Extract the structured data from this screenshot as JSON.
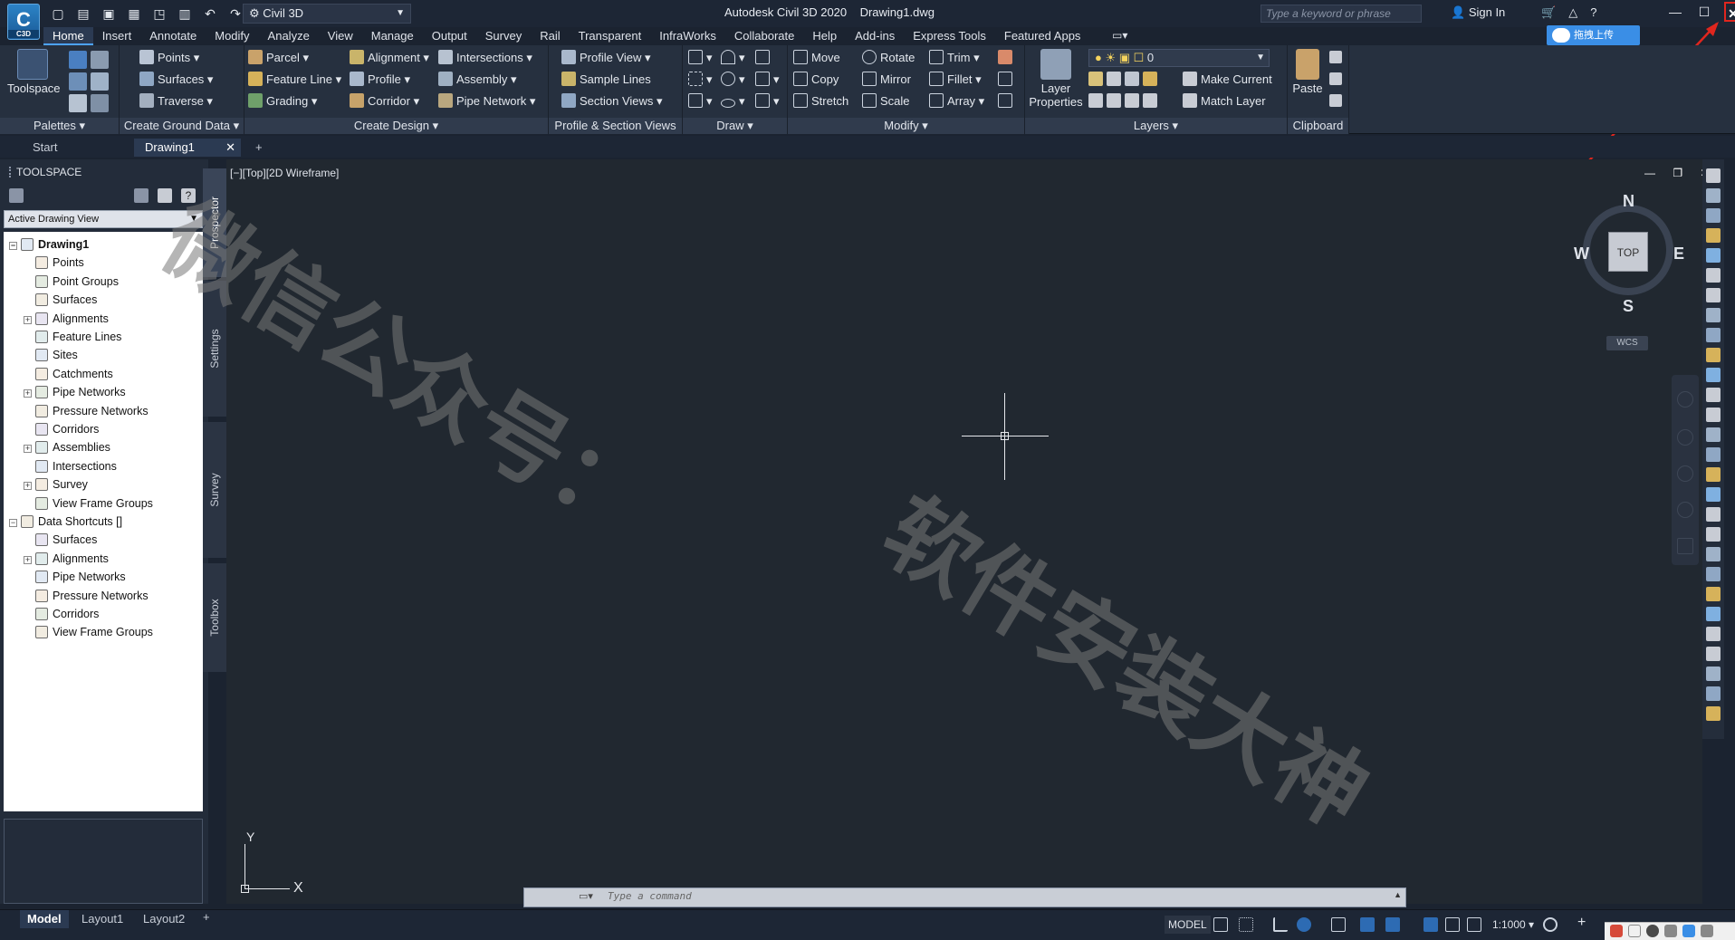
{
  "titlebar": {
    "app_badge": "C3D",
    "workspace": "Civil 3D",
    "title": "Autodesk Civil 3D 2020    Drawing1.dwg",
    "search_placeholder": "Type a keyword or phrase",
    "signin": "Sign In",
    "upload_label": "拖拽上传"
  },
  "menu": {
    "tabs": [
      "Home",
      "Insert",
      "Annotate",
      "Modify",
      "Analyze",
      "View",
      "Manage",
      "Output",
      "Survey",
      "Rail",
      "Transparent",
      "InfraWorks",
      "Collaborate",
      "Help",
      "Add-ins",
      "Express Tools",
      "Featured Apps"
    ],
    "active": "Home"
  },
  "ribbon": {
    "toolspace": "Toolspace",
    "palettes": "Palettes",
    "ground": {
      "title": "Create Ground Data",
      "items": [
        "Points",
        "Surfaces",
        "Traverse"
      ]
    },
    "design": {
      "title": "Create Design",
      "col1": [
        "Parcel",
        "Feature Line",
        "Grading"
      ],
      "col2": [
        "Alignment",
        "Profile",
        "Corridor"
      ],
      "col3": [
        "Intersections",
        "Assembly",
        "Pipe Network"
      ]
    },
    "profile": {
      "title": "Profile & Section Views",
      "items": [
        "Profile View",
        "Sample Lines",
        "Section Views"
      ]
    },
    "draw": {
      "title": "Draw"
    },
    "modify": {
      "title": "Modify",
      "col1": [
        "Move",
        "Copy",
        "Stretch"
      ],
      "col2": [
        "Rotate",
        "Mirror",
        "Scale"
      ],
      "col3": [
        "Trim",
        "Fillet",
        "Array"
      ]
    },
    "layers": {
      "title": "Layers",
      "layer_properties": "Layer\nProperties",
      "current_layer": "0",
      "make_current": "Make Current",
      "match_layer": "Match Layer"
    },
    "clipboard": {
      "title": "Clipboard",
      "paste": "Paste"
    }
  },
  "filetabs": {
    "start": "Start",
    "drawing": "Drawing1"
  },
  "toolspace": {
    "header": "TOOLSPACE",
    "view_select": "Active Drawing View",
    "tabs": [
      "Prospector",
      "Settings",
      "Survey",
      "Toolbox"
    ],
    "tree": [
      {
        "label": "Drawing1",
        "level": 0,
        "expander": "-",
        "bold": true
      },
      {
        "label": "Points",
        "level": 1,
        "expander": ""
      },
      {
        "label": "Point Groups",
        "level": 1,
        "expander": ""
      },
      {
        "label": "Surfaces",
        "level": 1,
        "expander": ""
      },
      {
        "label": "Alignments",
        "level": 1,
        "expander": "+"
      },
      {
        "label": "Feature Lines",
        "level": 1,
        "expander": ""
      },
      {
        "label": "Sites",
        "level": 1,
        "expander": ""
      },
      {
        "label": "Catchments",
        "level": 1,
        "expander": ""
      },
      {
        "label": "Pipe Networks",
        "level": 1,
        "expander": "+"
      },
      {
        "label": "Pressure Networks",
        "level": 1,
        "expander": ""
      },
      {
        "label": "Corridors",
        "level": 1,
        "expander": ""
      },
      {
        "label": "Assemblies",
        "level": 1,
        "expander": "+"
      },
      {
        "label": "Intersections",
        "level": 1,
        "expander": ""
      },
      {
        "label": "Survey",
        "level": 1,
        "expander": "+"
      },
      {
        "label": "View Frame Groups",
        "level": 1,
        "expander": ""
      },
      {
        "label": "Data Shortcuts []",
        "level": 0,
        "expander": "-"
      },
      {
        "label": "Surfaces",
        "level": 1,
        "expander": ""
      },
      {
        "label": "Alignments",
        "level": 1,
        "expander": "+"
      },
      {
        "label": "Pipe Networks",
        "level": 1,
        "expander": ""
      },
      {
        "label": "Pressure Networks",
        "level": 1,
        "expander": ""
      },
      {
        "label": "Corridors",
        "level": 1,
        "expander": ""
      },
      {
        "label": "View Frame Groups",
        "level": 1,
        "expander": ""
      }
    ]
  },
  "viewport": {
    "label": "[−][Top][2D Wireframe]",
    "cube_face": "TOP",
    "compass": {
      "n": "N",
      "s": "S",
      "e": "E",
      "w": "W"
    },
    "wcs": "WCS",
    "ucs_x": "X",
    "ucs_y": "Y"
  },
  "watermark": {
    "line1": "微信公众号：",
    "line2": "软件安装大神"
  },
  "command": {
    "placeholder": "Type a command"
  },
  "status": {
    "tabs": [
      "Model",
      "Layout1",
      "Layout2"
    ],
    "model_label": "MODEL",
    "scale": "1:1000"
  },
  "colors": {
    "accent": "#4da3ff",
    "close_highlight": "#e0261e",
    "arrow": "#e0261e"
  }
}
